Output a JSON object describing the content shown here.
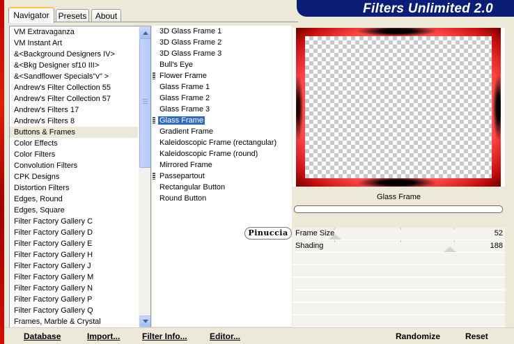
{
  "app": {
    "title": "Filters Unlimited 2.0"
  },
  "tabs": [
    {
      "label": "Navigator",
      "active": true
    },
    {
      "label": "Presets",
      "active": false
    },
    {
      "label": "About",
      "active": false
    }
  ],
  "categories": {
    "selected": "Buttons & Frames",
    "items": [
      "VM Extravaganza",
      "VM Instant Art",
      "&<Background Designers IV>",
      "&<Bkg Designer sf10 III>",
      "&<Sandflower Specials\"v\" >",
      "Andrew's Filter Collection 55",
      "Andrew's Filter Collection 57",
      "Andrew's Filters 17",
      "Andrew's Filters 8",
      "Buttons & Frames",
      "Color Effects",
      "Color Filters",
      "Convolution Filters",
      "CPK Designs",
      "Distortion Filters",
      "Edges, Round",
      "Edges, Square",
      "Filter Factory Gallery C",
      "Filter Factory Gallery D",
      "Filter Factory Gallery E",
      "Filter Factory Gallery H",
      "Filter Factory Gallery J",
      "Filter Factory Gallery M",
      "Filter Factory Gallery N",
      "Filter Factory Gallery P",
      "Filter Factory Gallery Q",
      "Frames, Marble & Crystal"
    ]
  },
  "filters": {
    "selected": "Glass Frame",
    "items": [
      "3D Glass Frame 1",
      "3D Glass Frame 2",
      "3D Glass Frame 3",
      "Bull's Eye",
      "Flower Frame",
      "Glass Frame 1",
      "Glass Frame 2",
      "Glass Frame 3",
      "Glass Frame",
      "Gradient Frame",
      "Kaleidoscopic Frame (rectangular)",
      "Kaleidoscopic Frame (round)",
      "Mirrored Frame",
      "Passepartout",
      "Rectangular Button",
      "Round Button"
    ],
    "marked": [
      "Flower Frame",
      "Glass Frame",
      "Passepartout"
    ]
  },
  "preview": {
    "filter_name": "Glass Frame",
    "progress": 0
  },
  "params": [
    {
      "label": "Frame Size",
      "value": "52",
      "level": 0.2
    },
    {
      "label": "Shading",
      "value": "188",
      "level": 0.74
    }
  ],
  "watermark": "Pinuccia",
  "buttons": {
    "database": "Database",
    "import": "Import...",
    "filter_info": "Filter Info...",
    "editor": "Editor...",
    "randomize": "Randomize",
    "reset": "Reset"
  },
  "colors": {
    "selection": "#316ac5",
    "banner": "#0a1e78",
    "frame_red": "#ff4a4a"
  }
}
